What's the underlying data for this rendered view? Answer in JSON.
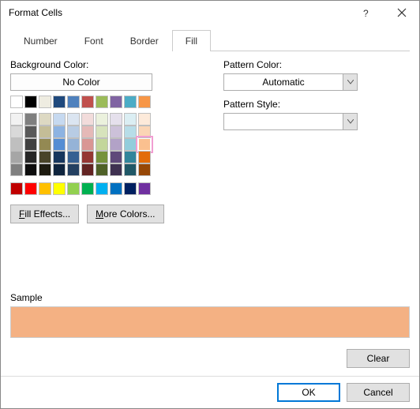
{
  "title": "Format Cells",
  "tabs": {
    "number": "Number",
    "font": "Font",
    "border": "Border",
    "fill": "Fill"
  },
  "bg_label": "Background Color:",
  "no_color": "No Color",
  "fill_effects": "Fill Effects...",
  "more_colors": "More Colors...",
  "pattern_color_label": "Pattern Color:",
  "pattern_color_value": "Automatic",
  "pattern_style_label": "Pattern Style:",
  "pattern_style_value": "",
  "sample_label": "Sample",
  "sample_color": "#f4b183",
  "clear": "Clear",
  "ok": "OK",
  "cancel": "Cancel",
  "palette_rows": [
    [
      "#ffffff",
      "#000000",
      "#eeece1",
      "#1f497d",
      "#4f81bd",
      "#c0504d",
      "#9bbb59",
      "#8064a2",
      "#4bacc6",
      "#f79646"
    ],
    [
      "#f2f2f2",
      "#7f7f7f",
      "#ddd9c3",
      "#c6d9f0",
      "#dbe5f1",
      "#f2dcdb",
      "#ebf1dd",
      "#e5e0ec",
      "#dbeef3",
      "#fdeada"
    ],
    [
      "#d9d9d9",
      "#595959",
      "#c4bd97",
      "#8db3e2",
      "#b8cce4",
      "#e5b9b7",
      "#d7e3bc",
      "#ccc1d9",
      "#b7dde8",
      "#fbd5b5"
    ],
    [
      "#bfbfbf",
      "#404040",
      "#938953",
      "#548dd4",
      "#95b3d7",
      "#d99694",
      "#c3d69b",
      "#b2a2c7",
      "#92cddc",
      "#fac08f"
    ],
    [
      "#a6a6a6",
      "#262626",
      "#494429",
      "#17365d",
      "#366092",
      "#953734",
      "#76923c",
      "#5f497a",
      "#31859b",
      "#e36c09"
    ],
    [
      "#808080",
      "#0d0d0d",
      "#1d1b10",
      "#0f243e",
      "#244061",
      "#632423",
      "#4f6128",
      "#3f3151",
      "#205867",
      "#974806"
    ]
  ],
  "std_row": [
    "#c00000",
    "#ff0000",
    "#ffc000",
    "#ffff00",
    "#92d050",
    "#00b050",
    "#00b0f0",
    "#0070c0",
    "#002060",
    "#7030a0"
  ],
  "selected": {
    "r": 3,
    "c": 9
  }
}
